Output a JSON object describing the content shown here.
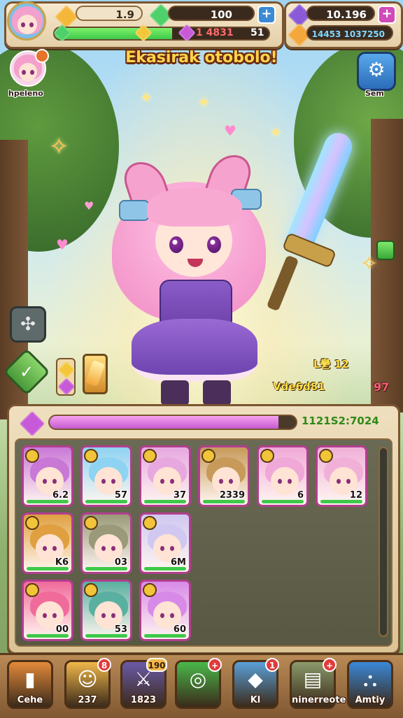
{
  "top_bar": {
    "level_value": "1.9",
    "energy_value": "100",
    "gem_value": "10.196",
    "xp_label": "1 4831",
    "xp_suffix": "51",
    "xp_progress": 0.55,
    "coin_value": "14453 1037250"
  },
  "profile": {
    "name": "hpeleno"
  },
  "event_title": "Ekasirak otobolo!",
  "settings": {
    "label": "Sem"
  },
  "side_stats": {
    "row1": "L㐦 12",
    "row2": "Vde6d81",
    "row2_value": "97"
  },
  "experience_bar": {
    "progress": 0.93,
    "value": "1121S2:7024"
  },
  "inventory": {
    "cards": [
      {
        "value": "6.2",
        "color": "#c978d6"
      },
      {
        "value": "57",
        "color": "#8fd3f2"
      },
      {
        "value": "37",
        "color": "#e7a8e0"
      },
      {
        "value": "2339",
        "color": "#c79a5a"
      },
      {
        "value": "6",
        "color": "#f0a8d8"
      },
      {
        "value": "12",
        "color": "#f0b0d8"
      },
      {
        "value": "K6",
        "color": "#e0a040"
      },
      {
        "value": "03",
        "color": "#9a9a7a"
      },
      {
        "value": "6M",
        "color": "#d0c8f0"
      },
      {
        "value": "00",
        "color": "#f06a9a"
      },
      {
        "value": "53",
        "color": "#5ab0a0"
      },
      {
        "value": "60",
        "color": "#d88ae8"
      }
    ]
  },
  "bottom_nav": [
    {
      "label": "Cehe",
      "badge": ""
    },
    {
      "label": "237",
      "badge": "8"
    },
    {
      "label": "1823",
      "badge": "190"
    },
    {
      "label": "",
      "badge": "+"
    },
    {
      "label": "Kl",
      "badge": "1"
    },
    {
      "label": "ninerreote",
      "badge": "+"
    },
    {
      "label": "Amtiy",
      "badge": ""
    }
  ],
  "colors": {
    "frame": "#7a5430",
    "xp_green": "#3ec94a",
    "exp_purple": "#d36ad8",
    "title_gold": "#ffd54a"
  }
}
